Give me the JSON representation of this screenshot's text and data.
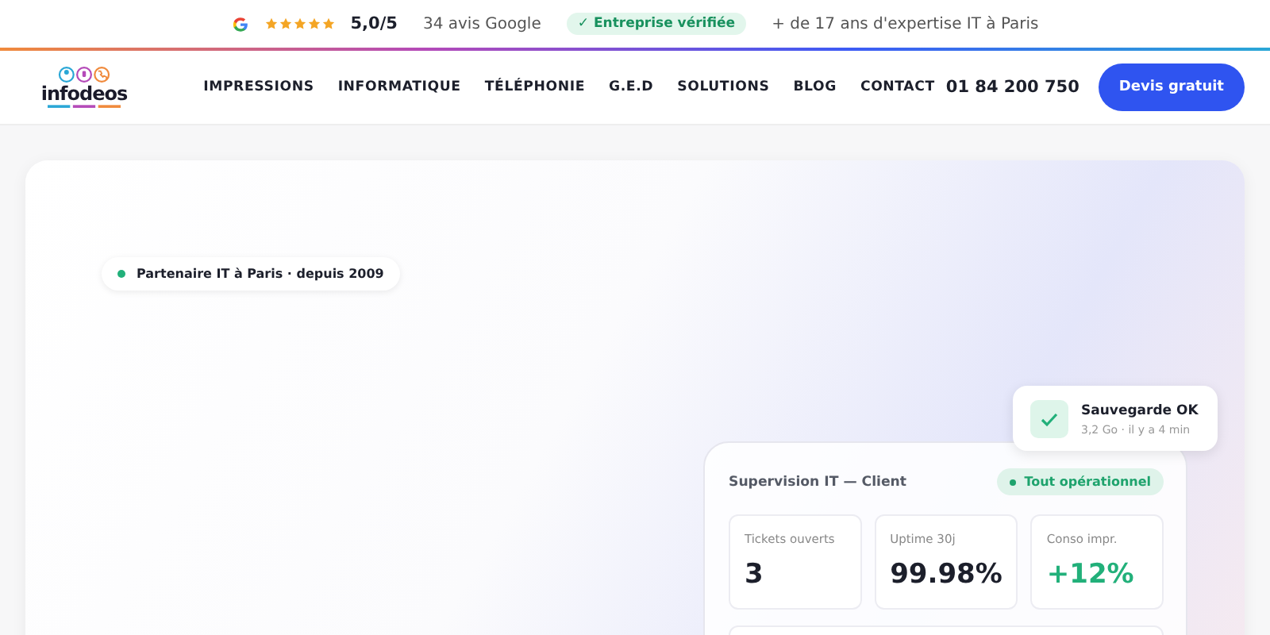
{
  "top_bar": {
    "rating": "5,0/5",
    "stars": 5,
    "reviews": "34  avis Google",
    "verified_badge": "✓ Entreprise vérifiée",
    "expertise": "+ de 17 ans d'expertise IT à Paris"
  },
  "header": {
    "logo_text": "infodeos",
    "nav": [
      "IMPRESSIONS",
      "INFORMATIQUE",
      "TÉLÉPHONIE",
      "G.E.D",
      "SOLUTIONS",
      "BLOG",
      "CONTACT"
    ],
    "phone": "01 84 200 750",
    "cta": "Devis gratuit"
  },
  "hero": {
    "badge": "Partenaire IT à Paris · depuis 2009"
  },
  "notification": {
    "title": "Sauvegarde OK",
    "subtitle": "3,2 Go · il y a 4 min"
  },
  "dashboard": {
    "title": "Supervision IT — Client",
    "status": "Tout opérationnel",
    "stats": [
      {
        "label": "Tickets ouverts",
        "value": "3",
        "kind": "neutral"
      },
      {
        "label": "Uptime 30j",
        "value": "99.98%",
        "kind": "neutral"
      },
      {
        "label": "Conso impr.",
        "value": "+12%",
        "kind": "positive"
      }
    ]
  }
}
